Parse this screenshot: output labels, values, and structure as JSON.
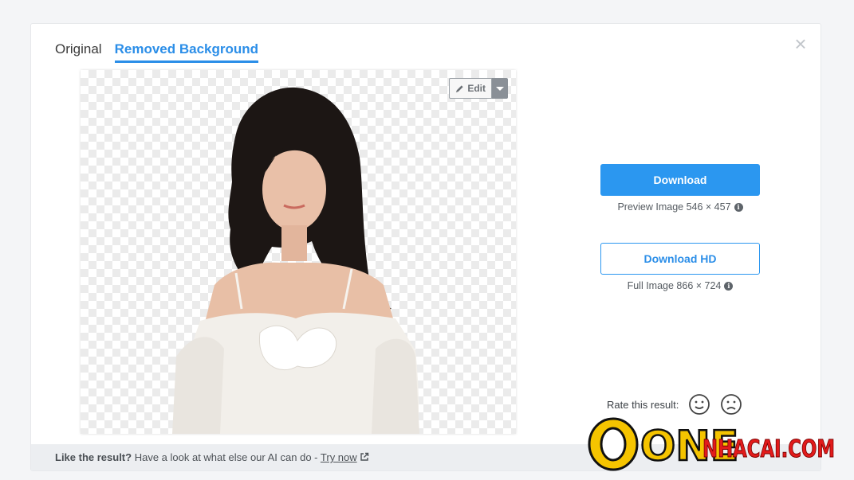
{
  "tabs": [
    {
      "label": "Original",
      "active": false
    },
    {
      "label": "Removed Background",
      "active": true
    }
  ],
  "editor": {
    "edit_label": "Edit"
  },
  "actions": {
    "download_label": "Download",
    "preview_info": "Preview Image 546 × 457",
    "download_hd_label": "Download HD",
    "full_info": "Full Image 866 × 724"
  },
  "rating": {
    "label": "Rate this result:"
  },
  "footer": {
    "lead": "Like the result?",
    "text": "Have a look at what else our AI can do -",
    "link": "Try now"
  },
  "watermark": {
    "text_one": "ONE",
    "text_site": "NHACAI.COM"
  },
  "colors": {
    "accent": "#2b97f0",
    "watermark_red": "#e21b1b",
    "watermark_yellow": "#f5c400"
  },
  "icons": [
    "close-icon",
    "pencil-icon",
    "caret-down-icon",
    "info-icon",
    "smile-icon",
    "frown-icon",
    "external-link-icon"
  ]
}
